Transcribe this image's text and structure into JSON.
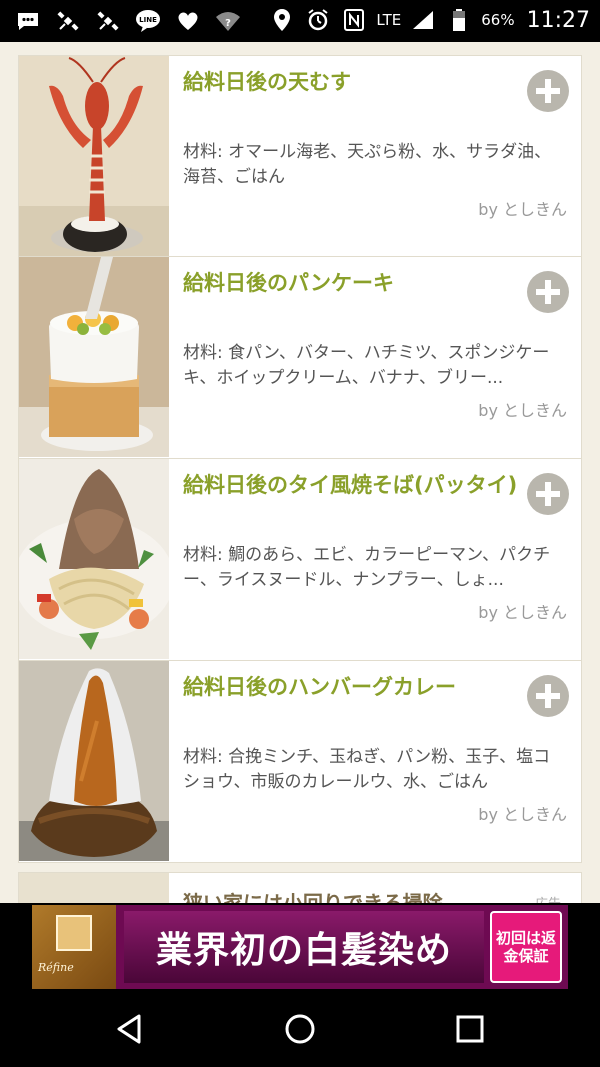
{
  "status_bar": {
    "network": "LTE",
    "battery": "66%",
    "time": "11:27",
    "icons": [
      "message-icon",
      "satellite-icon",
      "satellite-icon",
      "line-app-icon",
      "heart-icon",
      "wifi-question-icon",
      "location-icon",
      "alarm-icon",
      "nfc-icon",
      "signal-icon",
      "battery-icon"
    ]
  },
  "recipes": [
    {
      "title": "給料日後の天むす",
      "ingredients": "材料: オマール海老、天ぷら粉、水、サラダ油、海苔、ごはん",
      "author": "by としきん",
      "image": "lobster-tenmusu"
    },
    {
      "title": "給料日後のパンケーキ",
      "ingredients": "材料: 食パン、バター、ハチミツ、スポンジケーキ、ホイップクリーム、バナナ、ブリー...",
      "author": "by としきん",
      "image": "toast-cake-tower"
    },
    {
      "title": "給料日後のタイ風焼そば(パッタイ)",
      "ingredients": "材料: 鯛のあら、エビ、カラーピーマン、パクチー、ライスヌードル、ナンプラー、しょ...",
      "author": "by としきん",
      "image": "sea-bream-pad-thai"
    },
    {
      "title": "給料日後のハンバーグカレー",
      "ingredients": "材料: 合挽ミンチ、玉ねぎ、パン粉、玉子、塩コショウ、市販のカレールウ、水、ごはん",
      "author": "by としきん",
      "image": "hamburg-curry-mountain"
    }
  ],
  "next_item": {
    "title": "狭い家には小回りできる掃除",
    "tag": "広告"
  },
  "ad": {
    "brand": "Réfine",
    "headline": "業界初の白髪染め",
    "badge": "初回は返金保証"
  },
  "nav": [
    "back-icon",
    "home-icon",
    "recents-icon"
  ],
  "colors": {
    "title_green": "#8aa02a",
    "background": "#f3efe4",
    "plus_gray": "#b9b6ad",
    "ad_magenta": "#6e0a52"
  }
}
